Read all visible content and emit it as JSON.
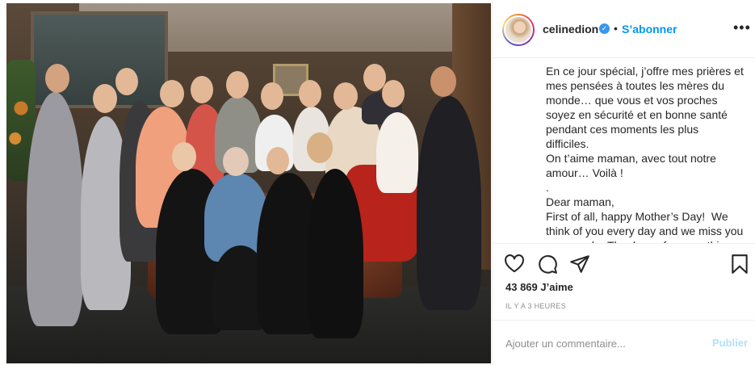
{
  "post": {
    "username": "celinedion",
    "verified_badge": "✓",
    "separator": "•",
    "follow_label": "S’abonner",
    "more_label": "•••",
    "caption_lines": [
      "En ce jour spécial, j’offre mes prières et mes pensées à toutes les mères du monde… que vous et vos proches soyez en sécurité et en bonne santé pendant ces moments les plus difficiles.",
      "On t’aime maman, avec tout notre amour… Voilà !",
      ".",
      "Dear maman,",
      "First of all, happy Mother’s Day!  We think of you every day and we miss you very much.  Thank you for everything."
    ],
    "likes_text": "43 869 J’aime",
    "time_text": "IL Y A 3 HEURES",
    "comment_placeholder": "Ajouter un commentaire...",
    "publish_label": "Publier",
    "icons": [
      "heart-icon",
      "comment-icon",
      "share-icon",
      "bookmark-icon"
    ],
    "colors": {
      "link": "#0095f6",
      "publish_disabled": "#b2dffc",
      "verified": "#3897f0",
      "muted": "#8e8e8e"
    }
  }
}
